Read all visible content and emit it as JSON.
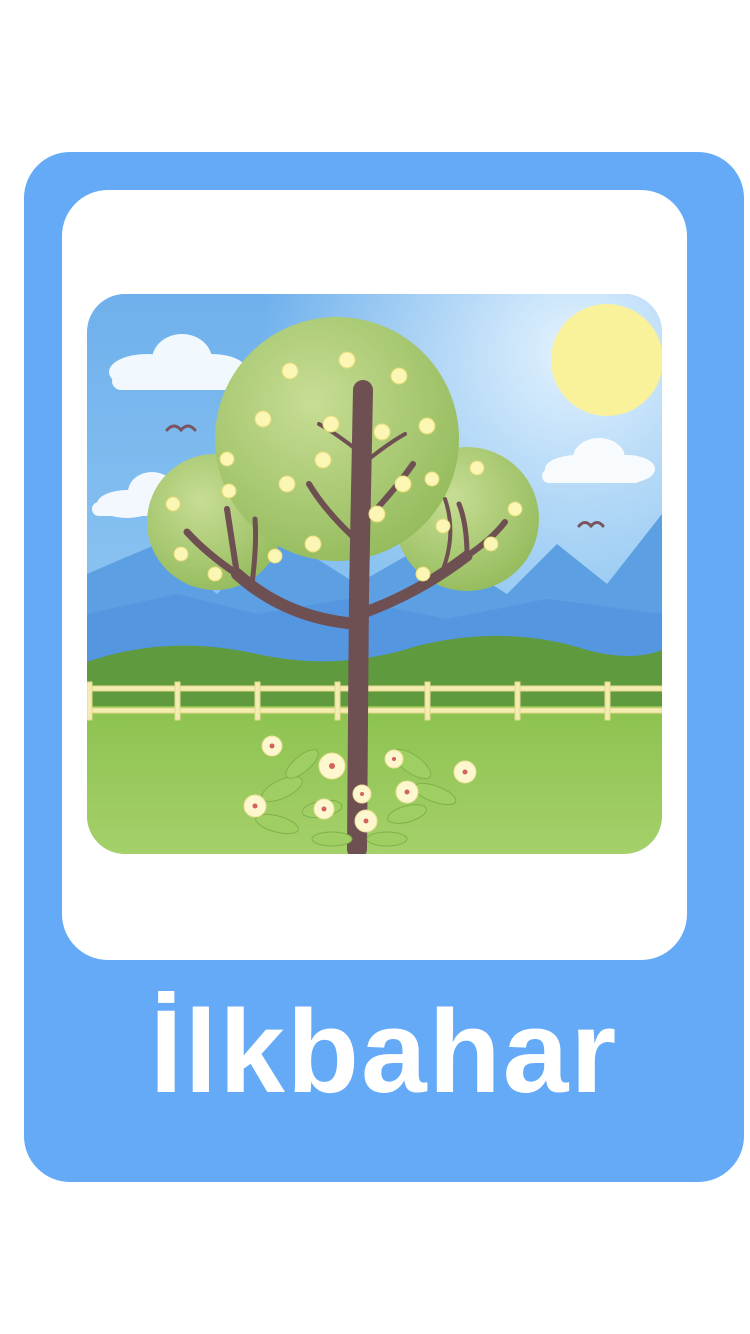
{
  "card": {
    "title": "İlkbahar",
    "colors": {
      "frame": "#64aaf6",
      "panel": "#ffffff",
      "title_text": "#ffffff"
    }
  },
  "illustration": {
    "subject": "spring-tree-scene",
    "elements": [
      "sun",
      "clouds",
      "birds",
      "mountains",
      "hills",
      "fence",
      "flowering-tree",
      "flower-bush"
    ]
  }
}
